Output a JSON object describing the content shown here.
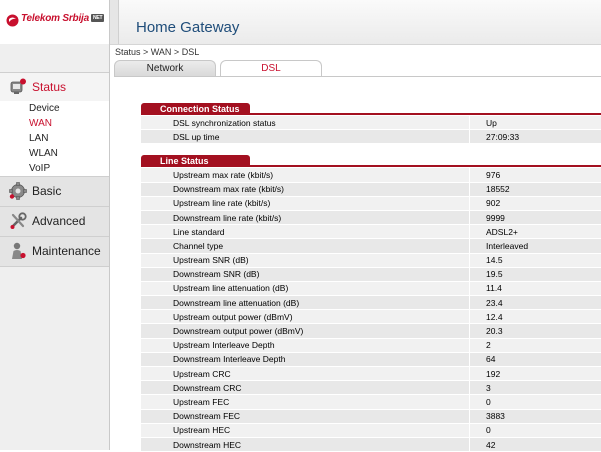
{
  "brand": {
    "name": "Telekom Srbija",
    "badge": "NET"
  },
  "header": {
    "title": "Home Gateway"
  },
  "breadcrumb": "Status > WAN > DSL",
  "tabs": [
    {
      "label": "Network"
    },
    {
      "label": "DSL"
    }
  ],
  "sidebar": {
    "status": {
      "label": "Status",
      "items": [
        "Device",
        "WAN",
        "LAN",
        "WLAN",
        "VoIP"
      ],
      "active": "WAN"
    },
    "basic": "Basic",
    "advanced": "Advanced",
    "maintenance": "Maintenance"
  },
  "connection_status": {
    "title": "Connection Status",
    "rows": [
      {
        "label": "DSL synchronization status",
        "value": "Up"
      },
      {
        "label": "DSL up time",
        "value": "27:09:33"
      }
    ]
  },
  "line_status": {
    "title": "Line Status",
    "rows": [
      {
        "label": "Upstream max rate (kbit/s)",
        "value": "976"
      },
      {
        "label": "Downstream max rate (kbit/s)",
        "value": "18552"
      },
      {
        "label": "Upstream line rate (kbit/s)",
        "value": "902"
      },
      {
        "label": "Downstream line rate (kbit/s)",
        "value": "9999"
      },
      {
        "label": "Line standard",
        "value": "ADSL2+"
      },
      {
        "label": "Channel type",
        "value": "Interleaved"
      },
      {
        "label": "Upstream SNR (dB)",
        "value": "14.5"
      },
      {
        "label": "Downstream SNR (dB)",
        "value": "19.5"
      },
      {
        "label": "Upstream line attenuation (dB)",
        "value": "11.4"
      },
      {
        "label": "Downstream line attenuation (dB)",
        "value": "23.4"
      },
      {
        "label": "Upstream output power (dBmV)",
        "value": "12.4"
      },
      {
        "label": "Downstream output power (dBmV)",
        "value": "20.3"
      },
      {
        "label": "Upstream Interleave Depth",
        "value": "2"
      },
      {
        "label": "Downstream Interleave Depth",
        "value": "64"
      },
      {
        "label": "Upstream CRC",
        "value": "192"
      },
      {
        "label": "Downstream CRC",
        "value": "3"
      },
      {
        "label": "Upstream FEC",
        "value": "0"
      },
      {
        "label": "Downstream FEC",
        "value": "3883"
      },
      {
        "label": "Upstream HEC",
        "value": "0"
      },
      {
        "label": "Downstream HEC",
        "value": "42"
      }
    ]
  },
  "colors": {
    "accent": "#c8102e",
    "section": "#a31020",
    "title": "#1f4d7a"
  },
  "icons": {
    "brand": "telekom-logo-icon",
    "status": "status-monitor-icon",
    "basic": "gear-icon",
    "advanced": "tools-icon",
    "maintenance": "person-maintenance-icon"
  }
}
